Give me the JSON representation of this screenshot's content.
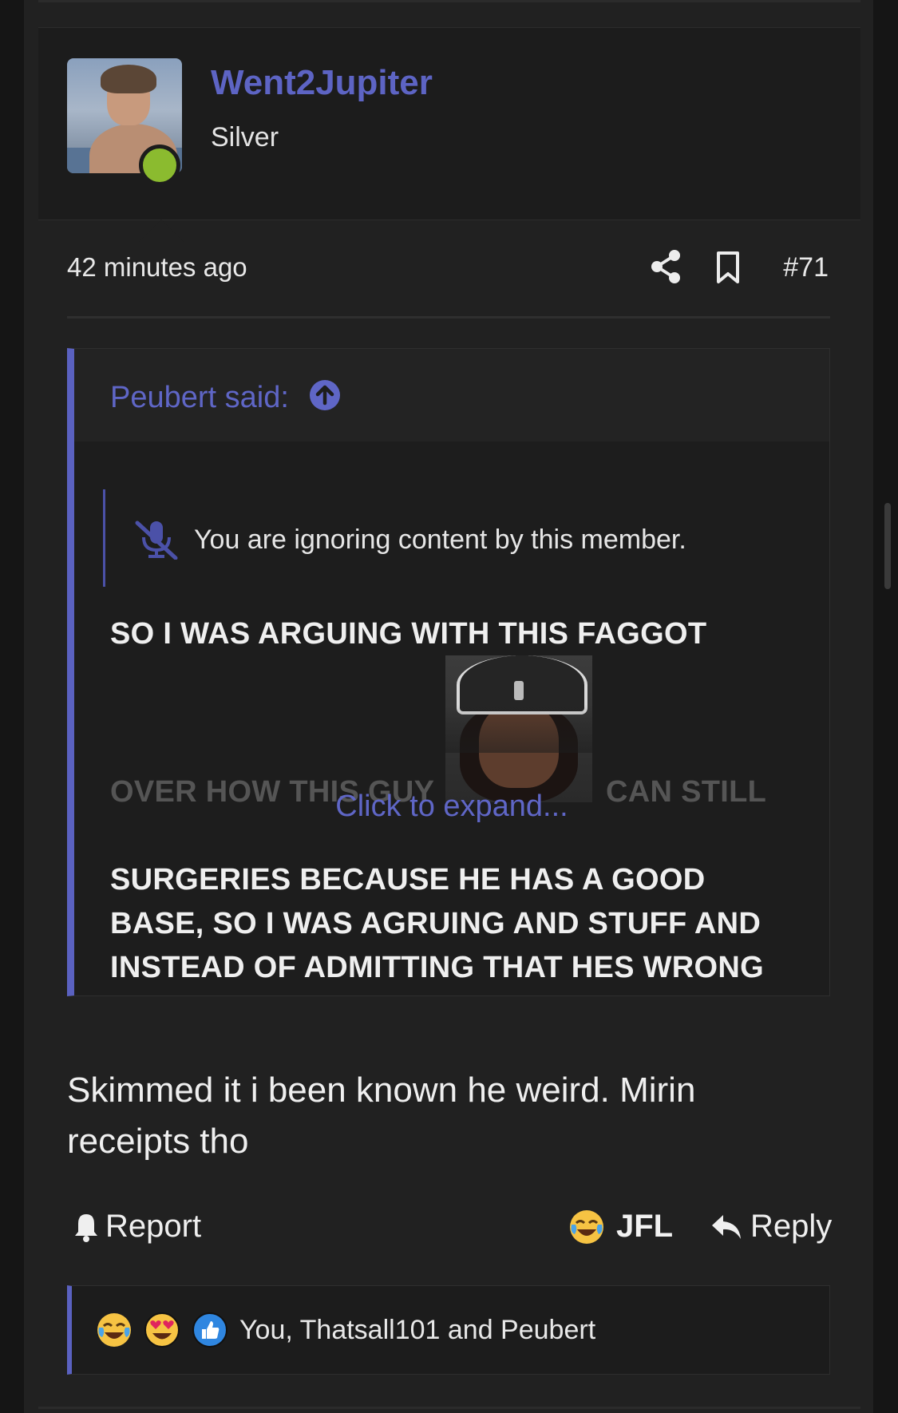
{
  "post": {
    "author": "Went2Jupiter",
    "user_title": "Silver",
    "time": "42 minutes ago",
    "number": "#71"
  },
  "quote": {
    "author": "Peubert said:",
    "ignored_notice": "You are ignoring content by this member.",
    "line1": "SO I WAS ARGUING WITH THIS FAGGOT",
    "line2a": "OVER HOW THIS GUY",
    "line2b": "CAN STILL",
    "line3": "SURGERIES BECAUSE HE HAS A GOOD",
    "line4": "BASE, SO I WAS AGRUING AND STUFF AND",
    "line5": "INSTEAD OF ADMITTING THAT HES WRONG",
    "expand": "Click to expand..."
  },
  "body": {
    "text": "Skimmed it i been known he weird. Mirin receipts tho"
  },
  "actions": {
    "report": "Report",
    "reaction": "JFL",
    "reply": "Reply"
  },
  "reactions": {
    "icons": [
      "crying-laughing-emoji",
      "heart-eyes-emoji",
      "thumbs-up-emoji"
    ],
    "names": "You, Thatsall101 and Peubert"
  },
  "colors": {
    "accent": "#5d64c4",
    "online": "#8bbb2f",
    "background": "#212121"
  }
}
